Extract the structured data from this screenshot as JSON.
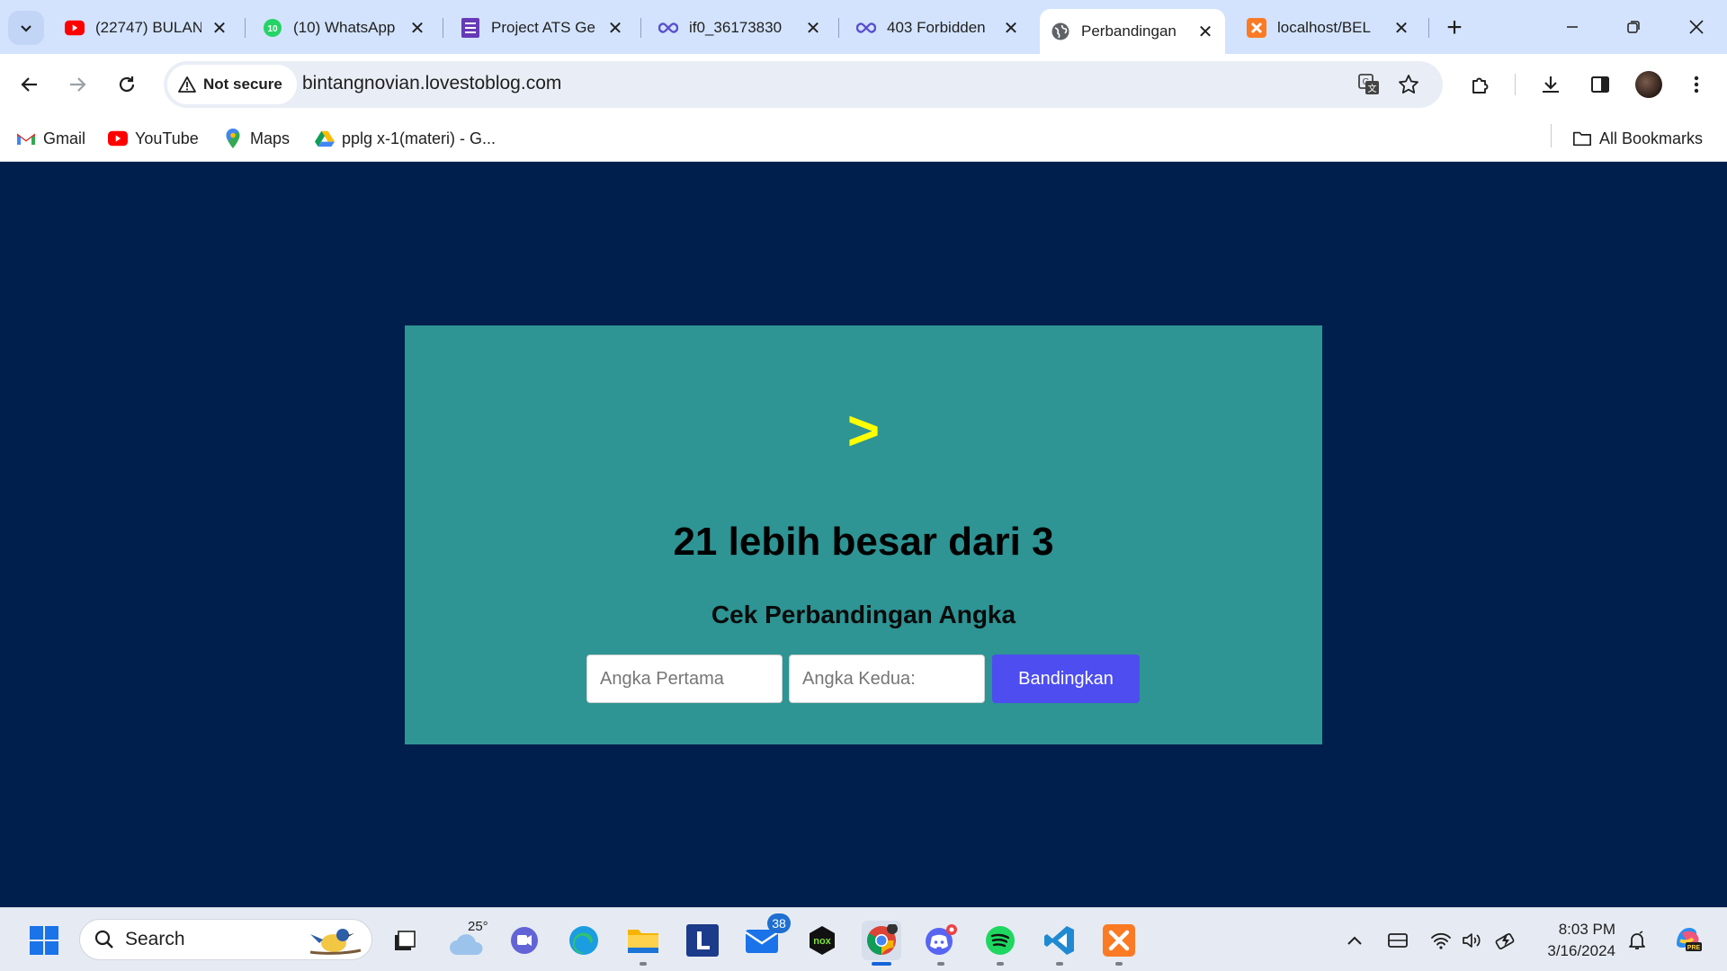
{
  "browser": {
    "tabs": [
      {
        "title": "(22747) BULAN",
        "icon": "youtube-icon"
      },
      {
        "title": "(10) WhatsApp",
        "icon": "whatsapp-icon"
      },
      {
        "title": "Project ATS Ge",
        "icon": "forms-icon"
      },
      {
        "title": "if0_36173830",
        "icon": "infinityfree-icon"
      },
      {
        "title": "403 Forbidden",
        "icon": "infinityfree-icon"
      },
      {
        "title": "Perbandingan",
        "icon": "globe-icon",
        "active": true
      },
      {
        "title": "localhost/BEL",
        "icon": "xampp-icon"
      }
    ],
    "address": {
      "security_label": "Not secure",
      "url": "bintangnovian.lovestoblog.com"
    },
    "bookmarks": [
      {
        "label": "Gmail",
        "icon": "gmail-icon"
      },
      {
        "label": "YouTube",
        "icon": "youtube-icon"
      },
      {
        "label": "Maps",
        "icon": "maps-icon"
      },
      {
        "label": "pplg x-1(materi) - G...",
        "icon": "drive-icon"
      }
    ],
    "all_bookmarks_label": "All Bookmarks"
  },
  "page": {
    "symbol": ">",
    "result": "21 lebih besar dari 3",
    "subtitle": "Cek Perbandingan Angka",
    "first_placeholder": "Angka Pertama",
    "second_placeholder": "Angka Kedua:",
    "button_label": "Bandingkan",
    "colors": {
      "background": "#001f4d",
      "card": "#2e9494",
      "symbol": "#ffff00",
      "button": "#4d4df0"
    }
  },
  "taskbar": {
    "search_label": "Search",
    "weather_temp": "25°",
    "mail_badge": "38",
    "time": "8:03 PM",
    "date": "3/16/2024"
  }
}
